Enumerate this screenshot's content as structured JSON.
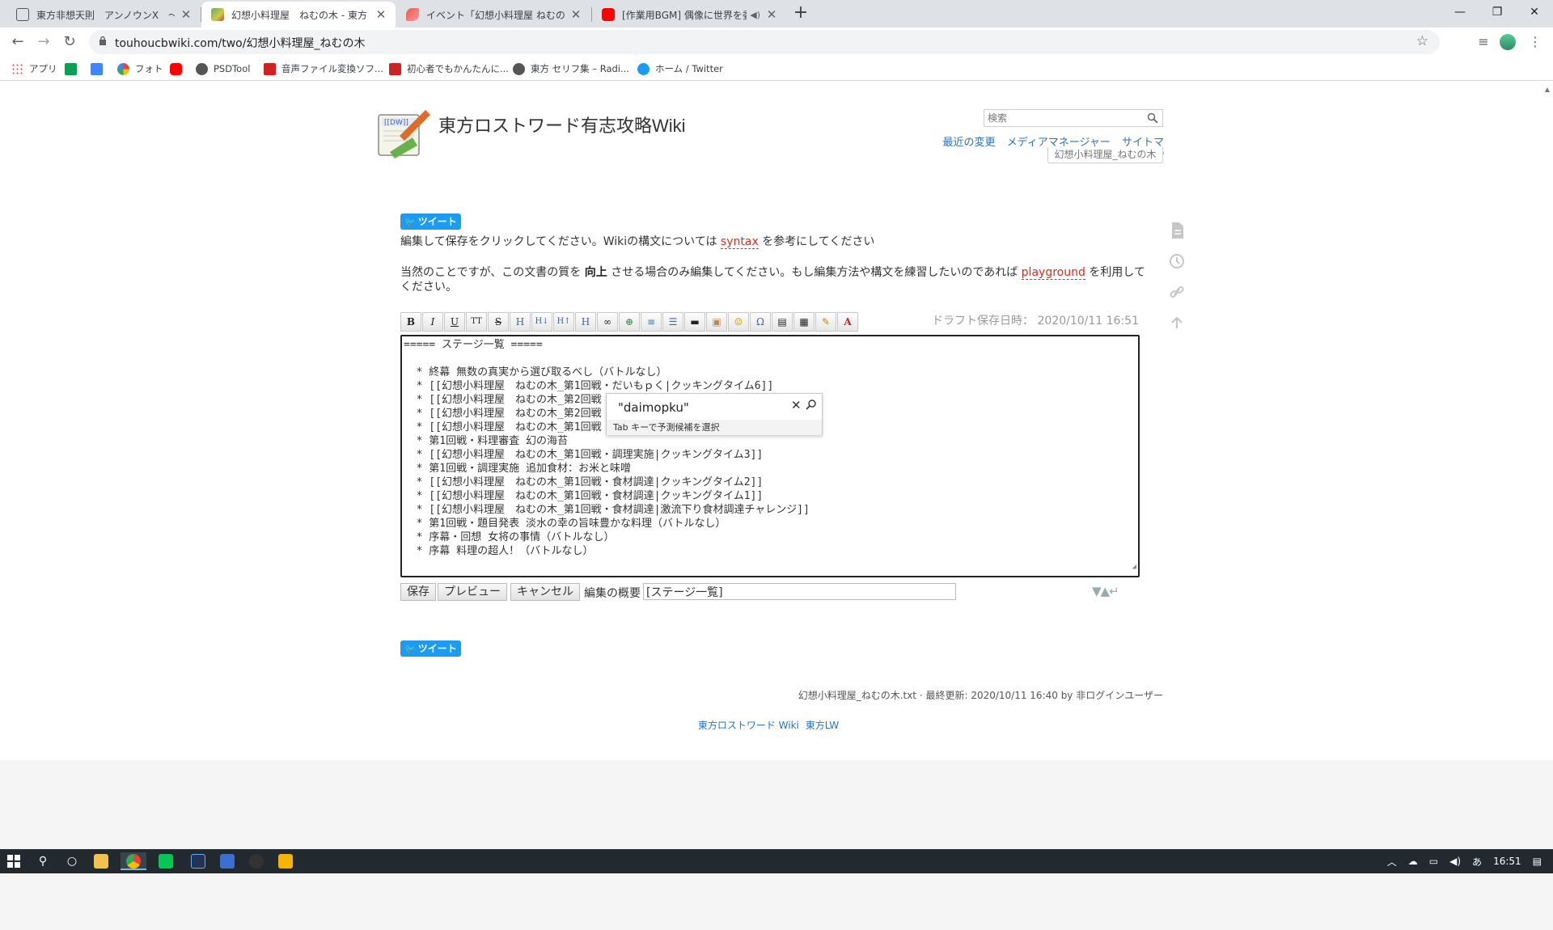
{
  "browser": {
    "tabs": [
      {
        "title": "東方非想天則　アンノウンX　～ U",
        "active": false
      },
      {
        "title": "幻想小料理屋　ねむの木 - 東方",
        "active": true
      },
      {
        "title": "イベント「幻想小料理屋 ねむの木」開",
        "active": false
      },
      {
        "title": "[作業用BGM] 偶像に世界を委",
        "active": false
      }
    ],
    "new_tab": "+",
    "url": "touhoucbwiki.com/two/幻想小料理屋_ねむの木",
    "window_controls": {
      "minimize": "—",
      "maximize": "❐",
      "close": "✕"
    },
    "bookmarks": [
      {
        "label": "アプリ",
        "icon": "apps-grid-icon",
        "color": "#4285f4"
      },
      {
        "label": "",
        "icon": "sheets-icon",
        "color": "#0f9d58"
      },
      {
        "label": "",
        "icon": "docs-icon",
        "color": "#4285f4"
      },
      {
        "label": "フォト",
        "icon": "photos-icon",
        "color": "#fbbc05"
      },
      {
        "label": "",
        "icon": "youtube-icon",
        "color": "#ff0000"
      },
      {
        "label": "PSDTool",
        "icon": "globe-icon",
        "color": "#555555"
      },
      {
        "label": "音声ファイル変換ソフ...",
        "icon": "nch-icon",
        "color": "#cc2222"
      },
      {
        "label": "初心者でもかんたんに...",
        "icon": "nch-icon",
        "color": "#cc2222"
      },
      {
        "label": "東方 セリフ集 – Radi...",
        "icon": "globe-icon",
        "color": "#555555"
      },
      {
        "label": "ホーム / Twitter",
        "icon": "twitter-icon",
        "color": "#1d9bf0"
      }
    ]
  },
  "site": {
    "title": "東方ロストワード有志攻略Wiki",
    "search_placeholder": "検索",
    "links": [
      "最近の変更",
      "メディアマネージャー",
      "サイトマップ"
    ],
    "breadcrumb": "幻想小料理屋_ねむの木"
  },
  "page": {
    "tweet_label": "ツイート",
    "intro1_before": "編集して保存をクリックしてください。Wikiの構文については ",
    "intro1_link": "syntax",
    "intro1_after": " を参考にしてください",
    "intro2_a": "当然のことですが、この文書の質を ",
    "intro2_bold": "向上",
    "intro2_b": " させる場合のみ編集してください。もし編集方法や構文を練習したいのであれば ",
    "intro2_link": "playground",
    "intro2_c": " を利用してください。",
    "draft_saved": "ドラフト保存日時： 2020/10/11 16:51",
    "toolbar_buttons": [
      "B",
      "I",
      "U",
      "TT",
      "S",
      "H",
      "H↓",
      "H↑",
      "H",
      "∞",
      "⊕",
      "≡",
      "☰",
      "▬",
      "▣",
      "☺",
      "Ω",
      "▤",
      "▦",
      "✎",
      "A"
    ],
    "editor_lines": [
      "===== ステージ一覧 =====",
      "",
      "  * 終幕 無数の真実から選び取るべし（バトルなし）",
      "  * [[幻想小料理屋　ねむの木_第1回戦・だいもｐく|クッキングタイム6]]",
      "  * [[幻想小料理屋　ねむの木_第2回戦",
      "  * [[幻想小料理屋　ねむの木_第2回戦",
      "  * [[幻想小料理屋　ねむの木_第1回戦",
      "  * 第1回戦・料理審査 幻の海苔",
      "  * [[幻想小料理屋　ねむの木_第1回戦・調理実施|クッキングタイム3]]",
      "  * 第1回戦・調理実施 追加食材：お米と味噌",
      "  * [[幻想小料理屋　ねむの木_第1回戦・食材調達|クッキングタイム2]]",
      "  * [[幻想小料理屋　ねむの木_第1回戦・食材調達|クッキングタイム1]]",
      "  * [[幻想小料理屋　ねむの木_第1回戦・食材調達|激流下り食材調達チャレンジ]]",
      "  * 第1回戦・題目発表 淡水の幸の旨味豊かな料理（バトルなし）",
      "  * 序幕・回想 女将の事情（バトルなし）",
      "  * 序幕 料理の超人！（バトルなし）"
    ],
    "ime": {
      "query": "\"daimopku\"",
      "hint": "Tab キーで予測候補を選択"
    },
    "save_label": "保存",
    "preview_label": "プレビュー",
    "cancel_label": "キャンセル",
    "summary_label": "編集の概要",
    "summary_value": "[ステージ一覧]",
    "doc_info": "幻想小料理屋_ねむの木.txt · 最終更新: 2020/10/11 16:40 by 非ログインユーザー",
    "footer": [
      "東方ロストワード Wiki",
      "東方LW"
    ]
  },
  "taskbar": {
    "clock": "16:51",
    "ime_mode": "あ"
  }
}
